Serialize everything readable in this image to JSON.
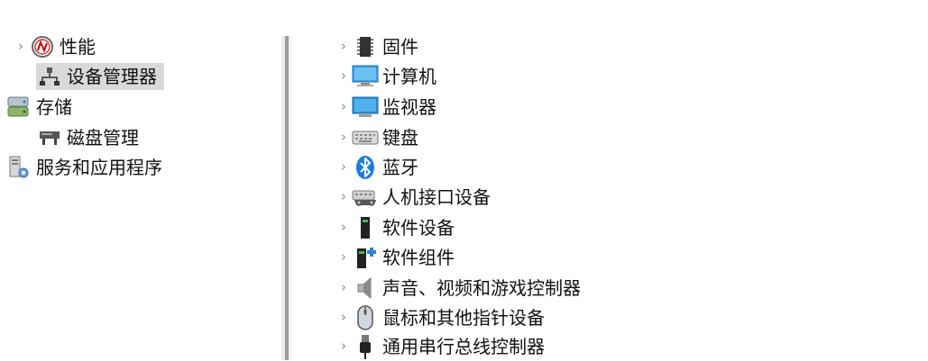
{
  "left_tree": {
    "items": [
      {
        "label": "性能",
        "icon": "performance-gauge-icon",
        "expander": "›"
      },
      {
        "label": "设备管理器",
        "icon": "device-manager-network-icon",
        "selected": true
      },
      {
        "label": "存储",
        "icon": "storage-icon"
      },
      {
        "label": "磁盘管理",
        "icon": "disk-management-icon"
      },
      {
        "label": "服务和应用程序",
        "icon": "services-applications-icon"
      }
    ]
  },
  "device_tree": {
    "expander": "›",
    "items": [
      {
        "label": "固件",
        "icon": "firmware-chip-icon"
      },
      {
        "label": "计算机",
        "icon": "computer-icon"
      },
      {
        "label": "监视器",
        "icon": "monitor-icon"
      },
      {
        "label": "键盘",
        "icon": "keyboard-icon"
      },
      {
        "label": "蓝牙",
        "icon": "bluetooth-icon"
      },
      {
        "label": "人机接口设备",
        "icon": "human-interface-device-icon"
      },
      {
        "label": "软件设备",
        "icon": "software-device-icon"
      },
      {
        "label": "软件组件",
        "icon": "software-component-icon"
      },
      {
        "label": "声音、视频和游戏控制器",
        "icon": "speaker-icon"
      },
      {
        "label": "鼠标和其他指针设备",
        "icon": "mouse-icon"
      },
      {
        "label": "通用串行总线控制器",
        "icon": "usb-connector-icon"
      }
    ]
  },
  "colors": {
    "selection_bg": "#d9d9d9",
    "bluetooth_blue": "#1e7be0",
    "monitor_blue": "#2d8fd6",
    "chevron": "#8a8a8a"
  }
}
